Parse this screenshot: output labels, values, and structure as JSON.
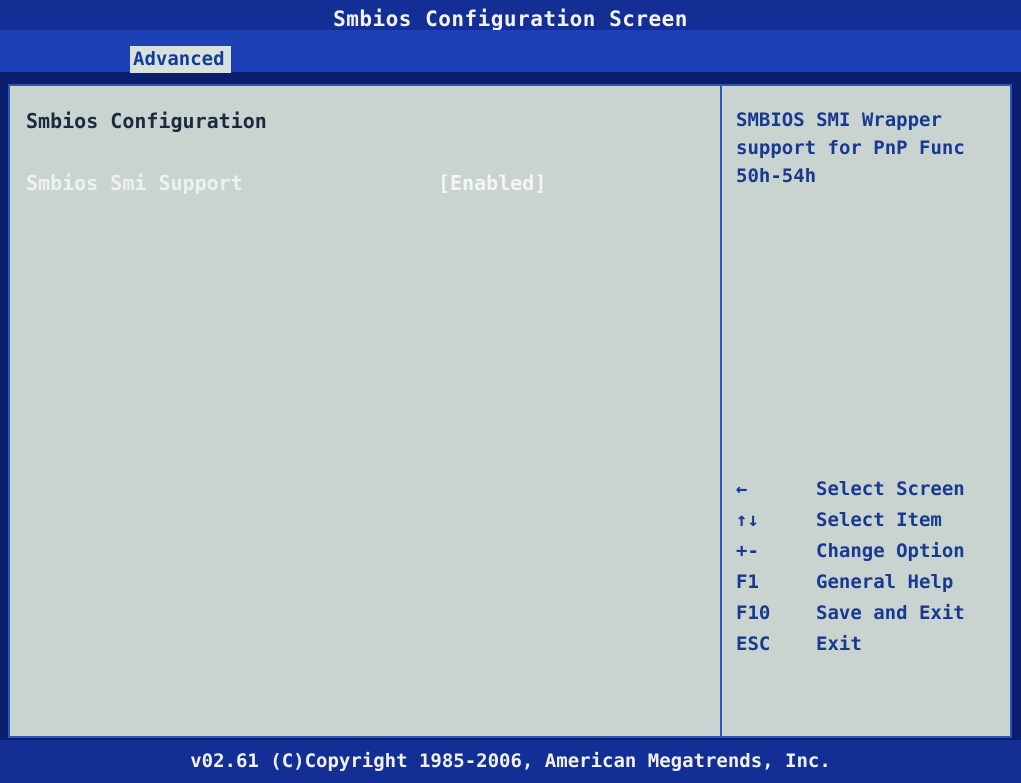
{
  "title": "Smbios Configuration Screen",
  "menu": {
    "active_tab": "Advanced"
  },
  "main": {
    "section_title": "Smbios Configuration",
    "setting": {
      "label": "Smbios Smi Support",
      "value": "[Enabled]"
    }
  },
  "help": {
    "lines": [
      "SMBIOS SMI Wrapper",
      "support for PnP Func",
      "50h-54h"
    ]
  },
  "keys": [
    {
      "key": "←",
      "action": "Select Screen"
    },
    {
      "key": "↑↓",
      "action": "Select Item"
    },
    {
      "key": "+-",
      "action": "Change Option"
    },
    {
      "key": "F1",
      "action": "General Help"
    },
    {
      "key": "F10",
      "action": "Save and Exit"
    },
    {
      "key": "ESC",
      "action": "Exit"
    }
  ],
  "footer": "v02.61 (C)Copyright 1985-2006, American Megatrends, Inc.",
  "colors": {
    "background": "#0b1f6e",
    "panel": "#c9d4d0",
    "accent_blue": "#17398f",
    "highlight_text": "#eef2ef"
  }
}
